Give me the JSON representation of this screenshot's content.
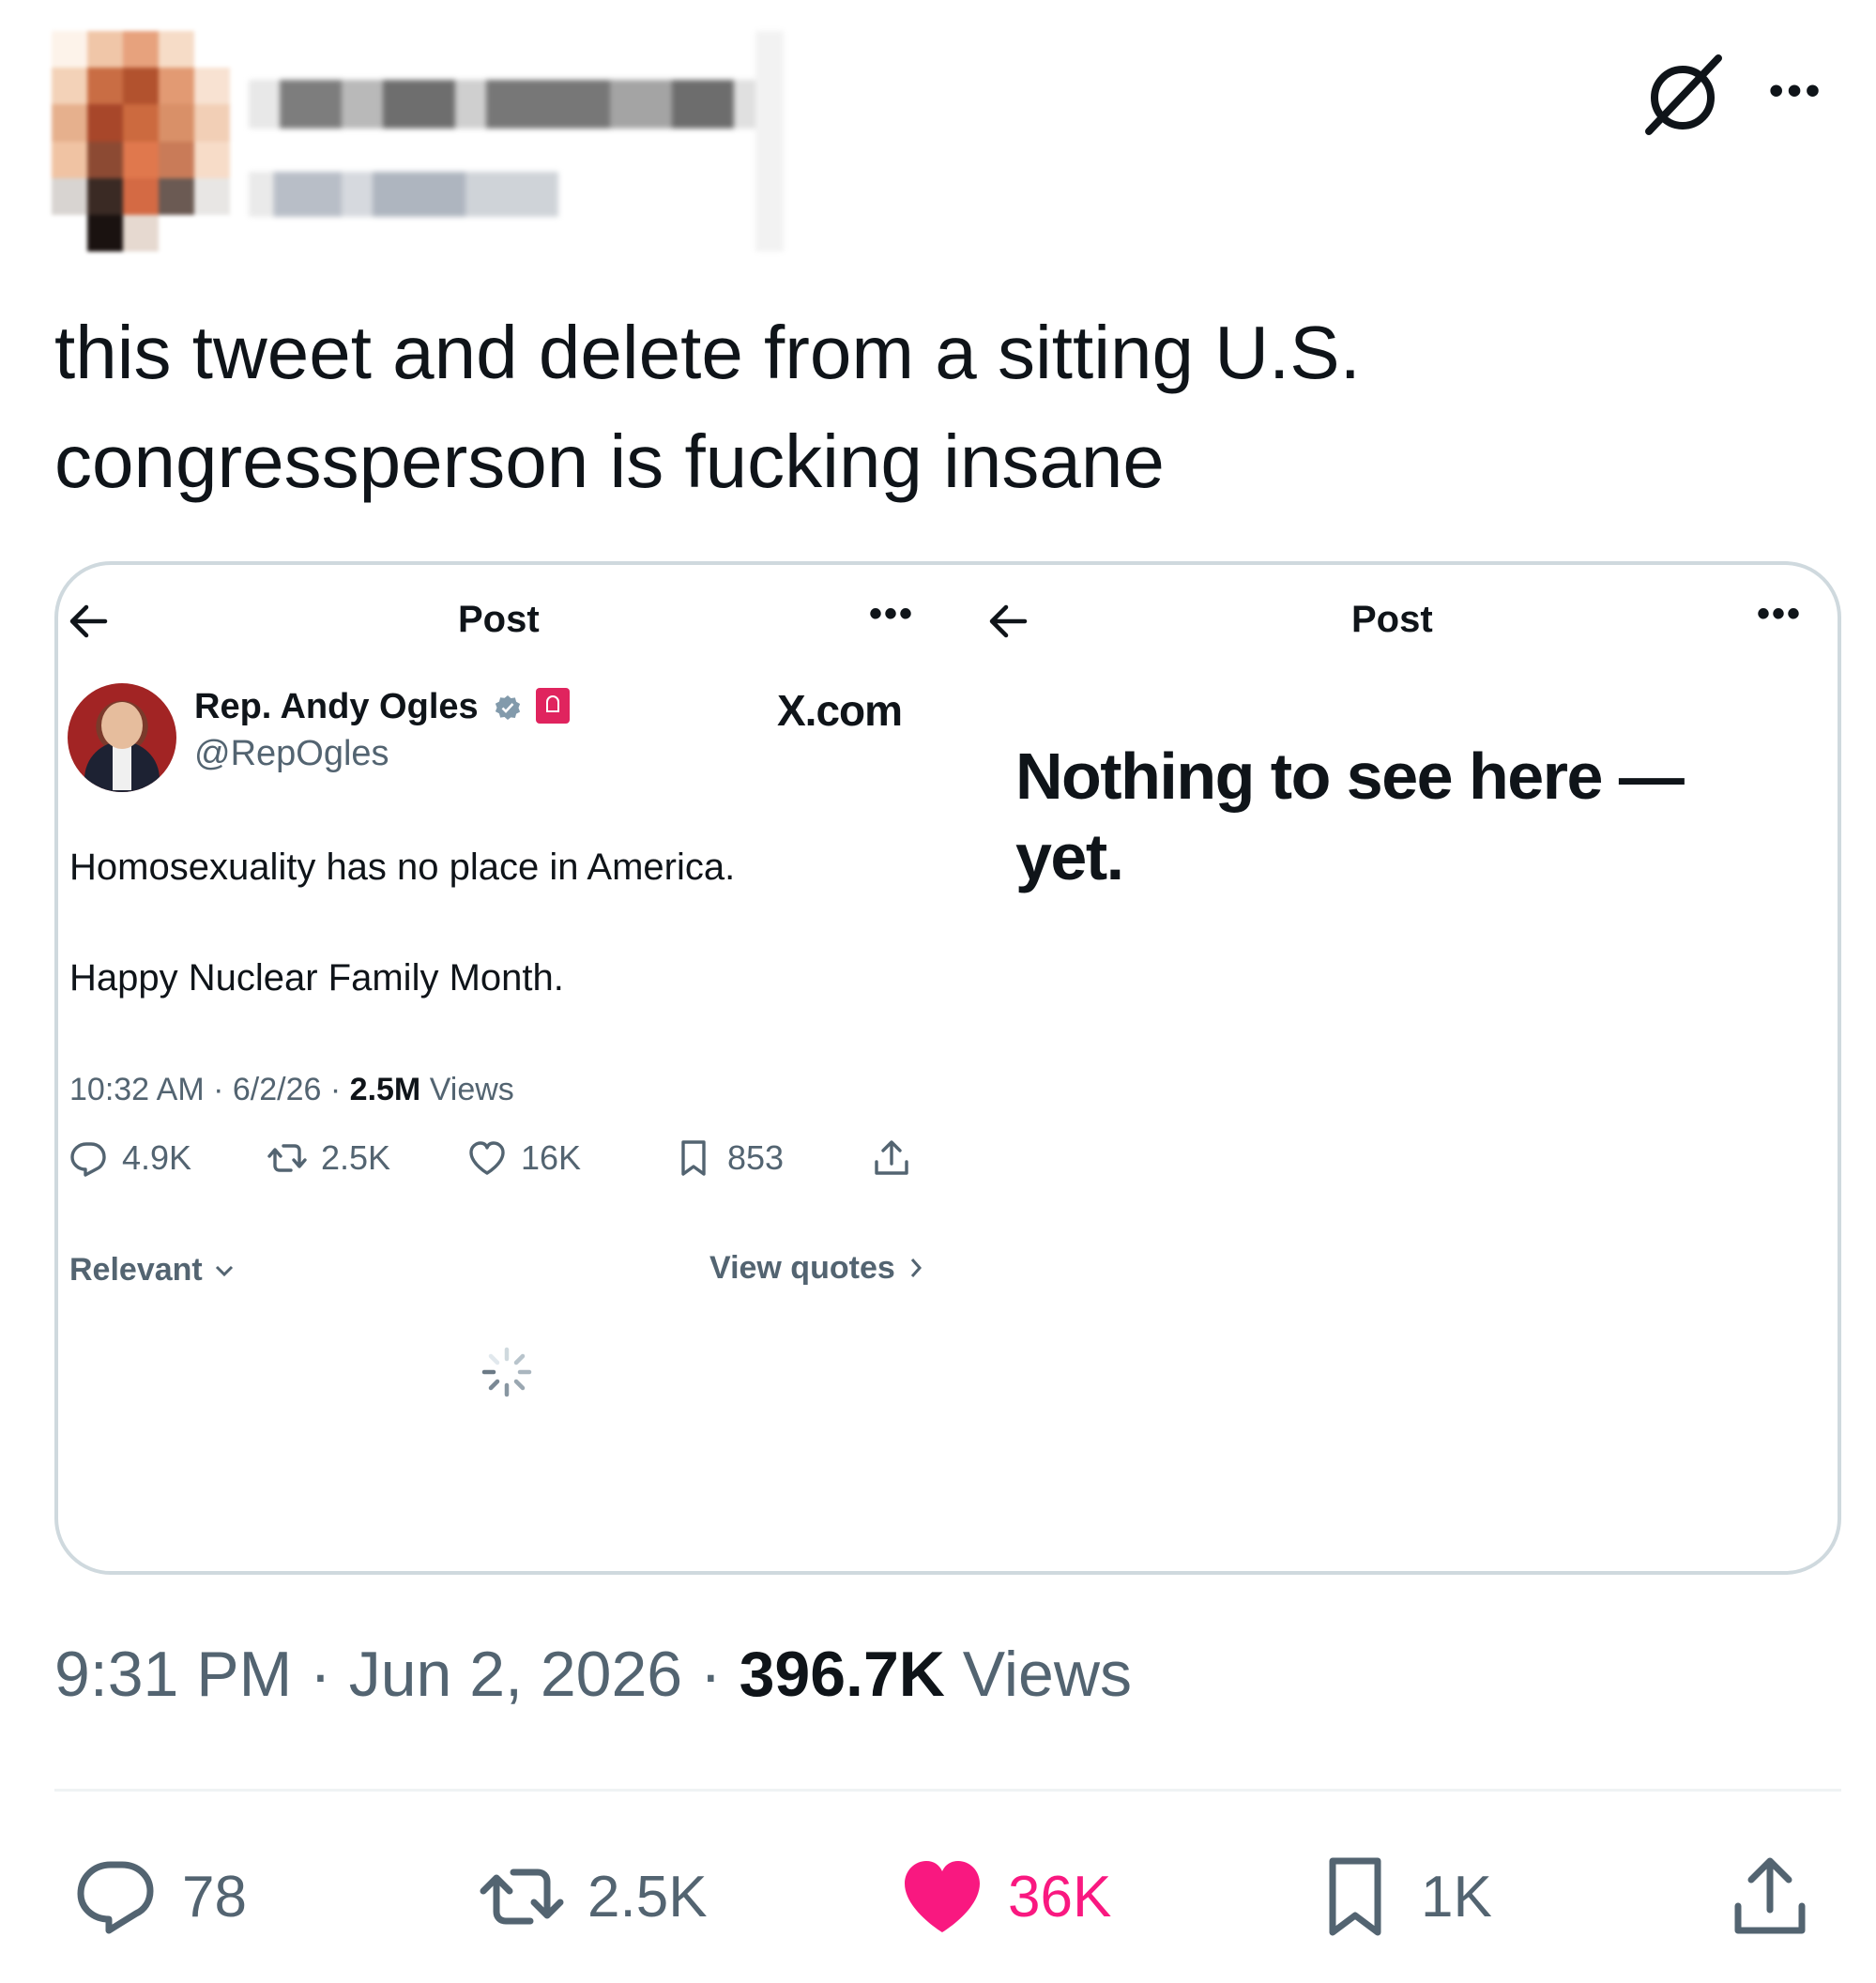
{
  "post": {
    "text_line_1": "this tweet and delete from a sitting U.S.",
    "text_line_2": "congressperson is fucking insane",
    "time": "9:31 PM",
    "date": "Jun 2, 2026",
    "views_count": "396.7K",
    "views_label": "Views",
    "sep": "·",
    "more_label": "•••",
    "grok_icon": "grok-icon",
    "actions": {
      "replies": "78",
      "reposts": "2.5K",
      "likes": "36K",
      "bookmarks": "1K"
    },
    "colors": {
      "like_active": "#f91880",
      "secondary_text": "#536471",
      "primary_text": "#0f1419"
    }
  },
  "screenshot": {
    "left": {
      "title": "Post",
      "more_label": "•••",
      "source": "X.com",
      "author_name": "Rep. Andy Ogles",
      "author_handle": "@RepOgles",
      "line_1": "Homosexuality has no place in America.",
      "line_2": "Happy Nuclear Family Month.",
      "time": "10:32 AM",
      "date": "6/2/26",
      "views_count": "2.5M",
      "views_label": "Views",
      "sep": "·",
      "replies": "4.9K",
      "reposts": "2.5K",
      "likes": "16K",
      "bookmarks": "853",
      "sort_label": "Relevant",
      "view_quotes_label": "View quotes"
    },
    "right": {
      "title": "Post",
      "more_label": "•••",
      "message": "Nothing to see here — yet."
    }
  }
}
